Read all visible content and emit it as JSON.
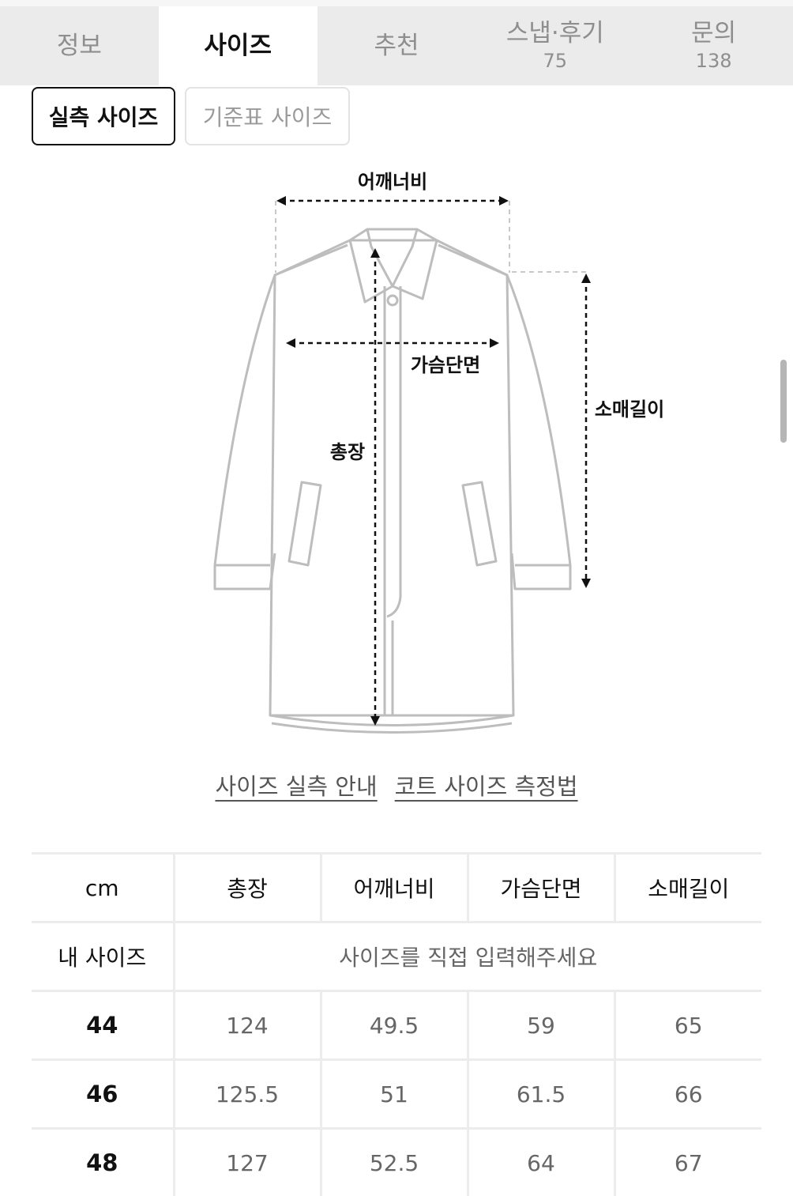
{
  "tabs": [
    {
      "label": "정보",
      "count": ""
    },
    {
      "label": "사이즈",
      "count": ""
    },
    {
      "label": "추천",
      "count": ""
    },
    {
      "label": "스냅·후기",
      "count": "75"
    },
    {
      "label": "문의",
      "count": "138"
    }
  ],
  "active_tab": "사이즈",
  "size_toggle": {
    "actual_label": "실측 사이즈",
    "standard_label": "기준표 사이즈",
    "selected": "실측 사이즈"
  },
  "diagram": {
    "labels": {
      "shoulder": "어깨너비",
      "chest": "가슴단면",
      "length": "총장",
      "sleeve": "소매길이"
    }
  },
  "links": {
    "guide": "사이즈 실측 안내",
    "method": "코트 사이즈 측정법"
  },
  "table": {
    "unit": "cm",
    "headers": [
      "총장",
      "어깨너비",
      "가슴단면",
      "소매길이"
    ],
    "my_size_label": "내 사이즈",
    "my_size_placeholder": "사이즈를 직접 입력해주세요",
    "rows": [
      {
        "size": "44",
        "values": [
          "124",
          "49.5",
          "59",
          "65"
        ]
      },
      {
        "size": "46",
        "values": [
          "125.5",
          "51",
          "61.5",
          "66"
        ]
      },
      {
        "size": "48",
        "values": [
          "127",
          "52.5",
          "64",
          "67"
        ]
      }
    ]
  }
}
